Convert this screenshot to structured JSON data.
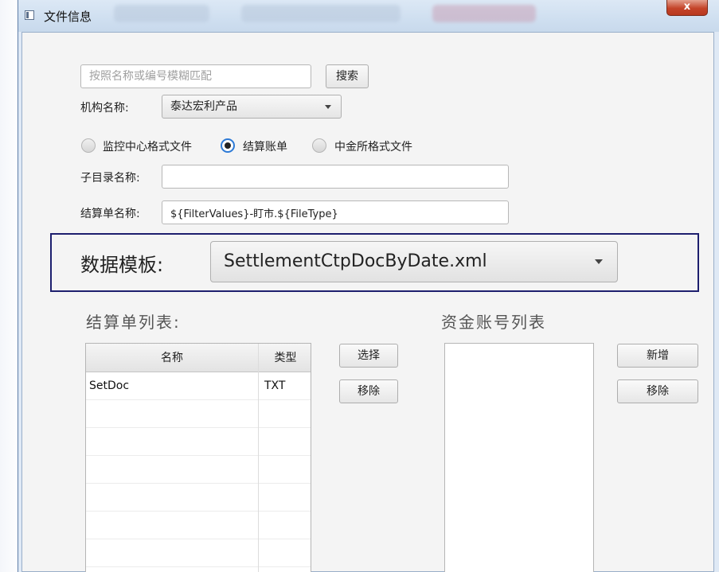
{
  "window": {
    "title": "文件信息",
    "close_label": "x"
  },
  "search": {
    "placeholder": "按照名称或编号模糊匹配",
    "value": "",
    "button_label": "搜索"
  },
  "org": {
    "label": "机构名称:",
    "selected": "泰达宏利产品"
  },
  "file_type": {
    "options": [
      {
        "label": "监控中心格式文件",
        "checked": false
      },
      {
        "label": "结算账单",
        "checked": true
      },
      {
        "label": "中金所格式文件",
        "checked": false
      }
    ]
  },
  "subdir": {
    "label": "子目录名称:",
    "value": ""
  },
  "settlement_name": {
    "label": "结算单名称:",
    "value": "${FilterValues}-盯市.${FileType}"
  },
  "template": {
    "label": "数据模板:",
    "selected": "SettlementCtpDocByDate.xml"
  },
  "settlement_list": {
    "title": "结算单列表:",
    "columns": [
      "名称",
      "类型"
    ],
    "rows": [
      [
        "SetDoc",
        "TXT"
      ],
      [
        "",
        ""
      ],
      [
        "",
        ""
      ],
      [
        "",
        ""
      ],
      [
        "",
        ""
      ],
      [
        "",
        ""
      ],
      [
        "",
        ""
      ],
      [
        "",
        ""
      ]
    ],
    "select_button": "选择",
    "remove_button": "移除"
  },
  "account_list": {
    "title": "资金账号列表",
    "add_button": "新增",
    "remove_button": "移除"
  }
}
